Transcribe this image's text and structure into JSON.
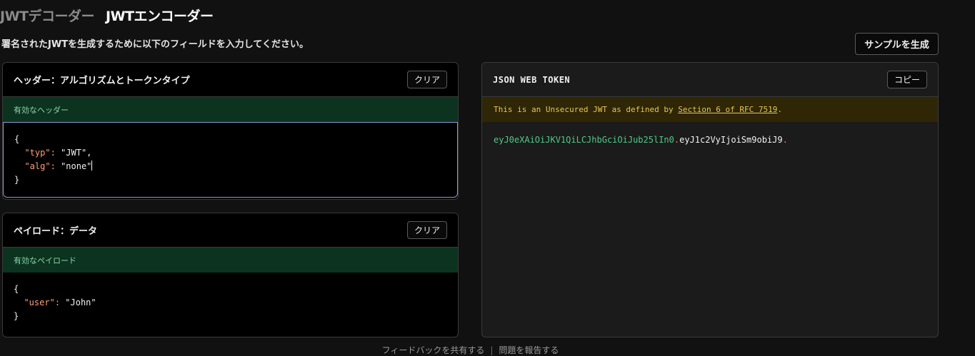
{
  "tabs": [
    {
      "label": "JWTデコーダー",
      "active": false
    },
    {
      "label": "JWTエンコーダー",
      "active": true
    }
  ],
  "instruction": "署名されたJWTを生成するために以下のフィールドを入力してください。",
  "sample_button": "サンプルを生成",
  "header_panel": {
    "title": "ヘッダー：アルゴリズムとトークンタイプ",
    "clear_label": "クリア",
    "status": "有効なヘッダー",
    "lines": {
      "open": "{",
      "typ_key": "\"typ\"",
      "typ_value": "\"JWT\",",
      "alg_key": "\"alg\"",
      "alg_value": "\"none\"",
      "close": "}"
    }
  },
  "payload_panel": {
    "title": "ペイロード：データ",
    "clear_label": "クリア",
    "status": "有効なペイロード",
    "lines": {
      "open": "{",
      "user_key": "\"user\"",
      "user_value": "\"John\"",
      "close": "}"
    }
  },
  "token_panel": {
    "title": "JSON WEB TOKEN",
    "copy_label": "コピー",
    "warning_prefix": "This is an Unsecured JWT as defined by ",
    "warning_link": "Section 6 of RFC 7519",
    "warning_suffix": ".",
    "token_header": "eyJ0eXAiOiJKV1QiLCJhbGciOiJub25lIn0",
    "token_payload": "eyJ1c2VyIjoiSm9obiJ9",
    "dot": "."
  },
  "footer": {
    "feedback": "フィードバックを共有する",
    "separator": "|",
    "report": "問題を報告する"
  },
  "colors": {
    "background": "#111111",
    "status_green": "#0b3320",
    "warning_bg": "#2e2605",
    "token_header": "#4fc98a",
    "json_key": "#ff9f73"
  }
}
